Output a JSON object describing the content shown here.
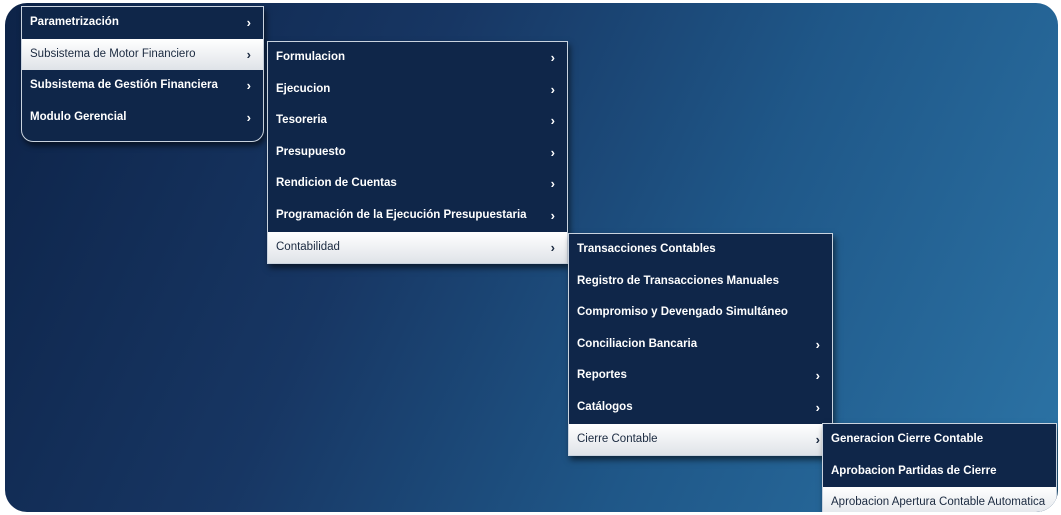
{
  "menu_level1": [
    {
      "label": "Parametrización",
      "arrow": "›"
    },
    {
      "label": "Subsistema de Motor Financiero",
      "arrow": "›",
      "active": true
    },
    {
      "label": "Subsistema de Gestión Financiera",
      "arrow": "›"
    },
    {
      "label": "Modulo Gerencial",
      "arrow": "›"
    }
  ],
  "menu_level2": [
    {
      "label": "Formulacion",
      "arrow": "›"
    },
    {
      "label": "Ejecucion",
      "arrow": "›"
    },
    {
      "label": "Tesoreria",
      "arrow": "›"
    },
    {
      "label": "Presupuesto",
      "arrow": "›"
    },
    {
      "label": "Rendicion de Cuentas",
      "arrow": "›"
    },
    {
      "label": "Programación de la Ejecución Presupuestaria",
      "arrow": "›"
    },
    {
      "label": "Contabilidad",
      "arrow": "›",
      "active": true
    }
  ],
  "menu_level3": [
    {
      "label": "Transacciones Contables",
      "arrow": ""
    },
    {
      "label": "Registro de Transacciones Manuales",
      "arrow": ""
    },
    {
      "label": "Compromiso y Devengado Simultáneo",
      "arrow": ""
    },
    {
      "label": "Conciliacion Bancaria",
      "arrow": "›"
    },
    {
      "label": "Reportes",
      "arrow": "›"
    },
    {
      "label": "Catálogos",
      "arrow": "›"
    },
    {
      "label": "Cierre Contable",
      "arrow": "›",
      "active": true
    }
  ],
  "menu_level4": [
    {
      "label": "Generacion Cierre Contable",
      "arrow": ""
    },
    {
      "label": "Aprobacion Partidas de Cierre",
      "arrow": ""
    },
    {
      "label": "Aprobacion Apertura Contable Automatica",
      "arrow": "",
      "active": true
    }
  ]
}
